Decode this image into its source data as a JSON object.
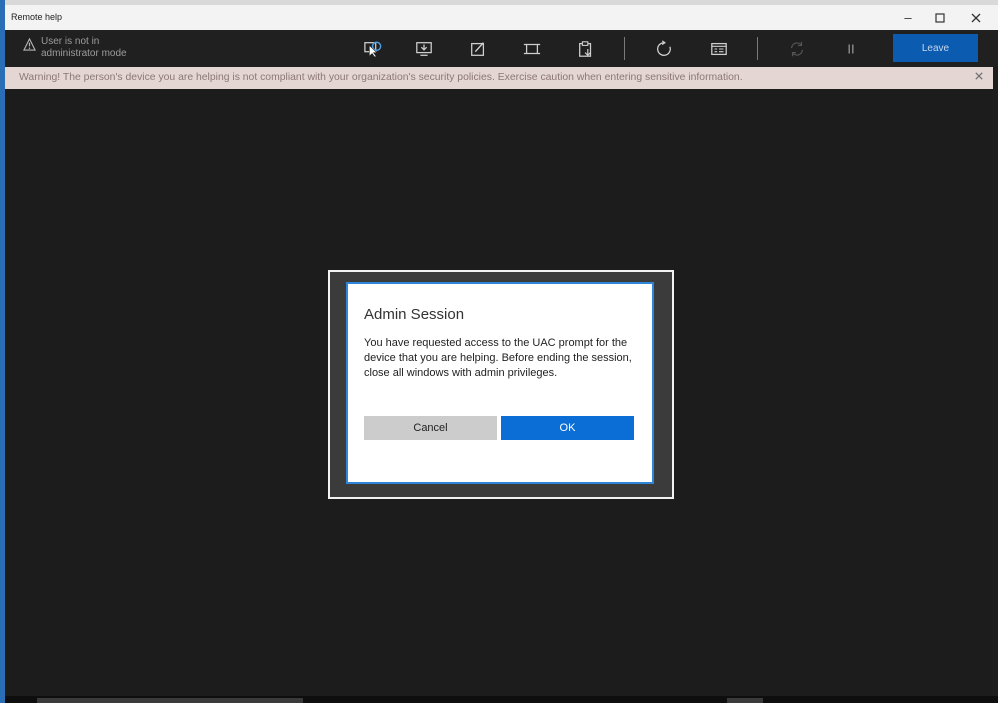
{
  "window": {
    "title": "Remote help"
  },
  "toolbar": {
    "admin_status": "User is not in administrator mode",
    "leave_label": "Leave",
    "icons": [
      "request-elevation-icon",
      "view-screen-icon",
      "annotate-icon",
      "fit-to-screen-icon",
      "clipboard-icon",
      "restart-icon",
      "task-manager-icon",
      "refresh-icon",
      "pause-icon"
    ]
  },
  "warning": {
    "text": "Warning! The person's device you are helping is not compliant with your organization's security policies. Exercise caution when entering sensitive information."
  },
  "dialog": {
    "title": "Admin Session",
    "body": "You have requested access to the UAC prompt for the device that you are helping. Before ending the session, close all windows with admin privileges.",
    "cancel_label": "Cancel",
    "ok_label": "OK"
  },
  "colors": {
    "accent": "#0a6ed6",
    "leave_button": "#0b5bb0",
    "warning_bar": "#e3d6d3",
    "dialog_border": "#2f86d8",
    "background": "#1c1c1c"
  }
}
